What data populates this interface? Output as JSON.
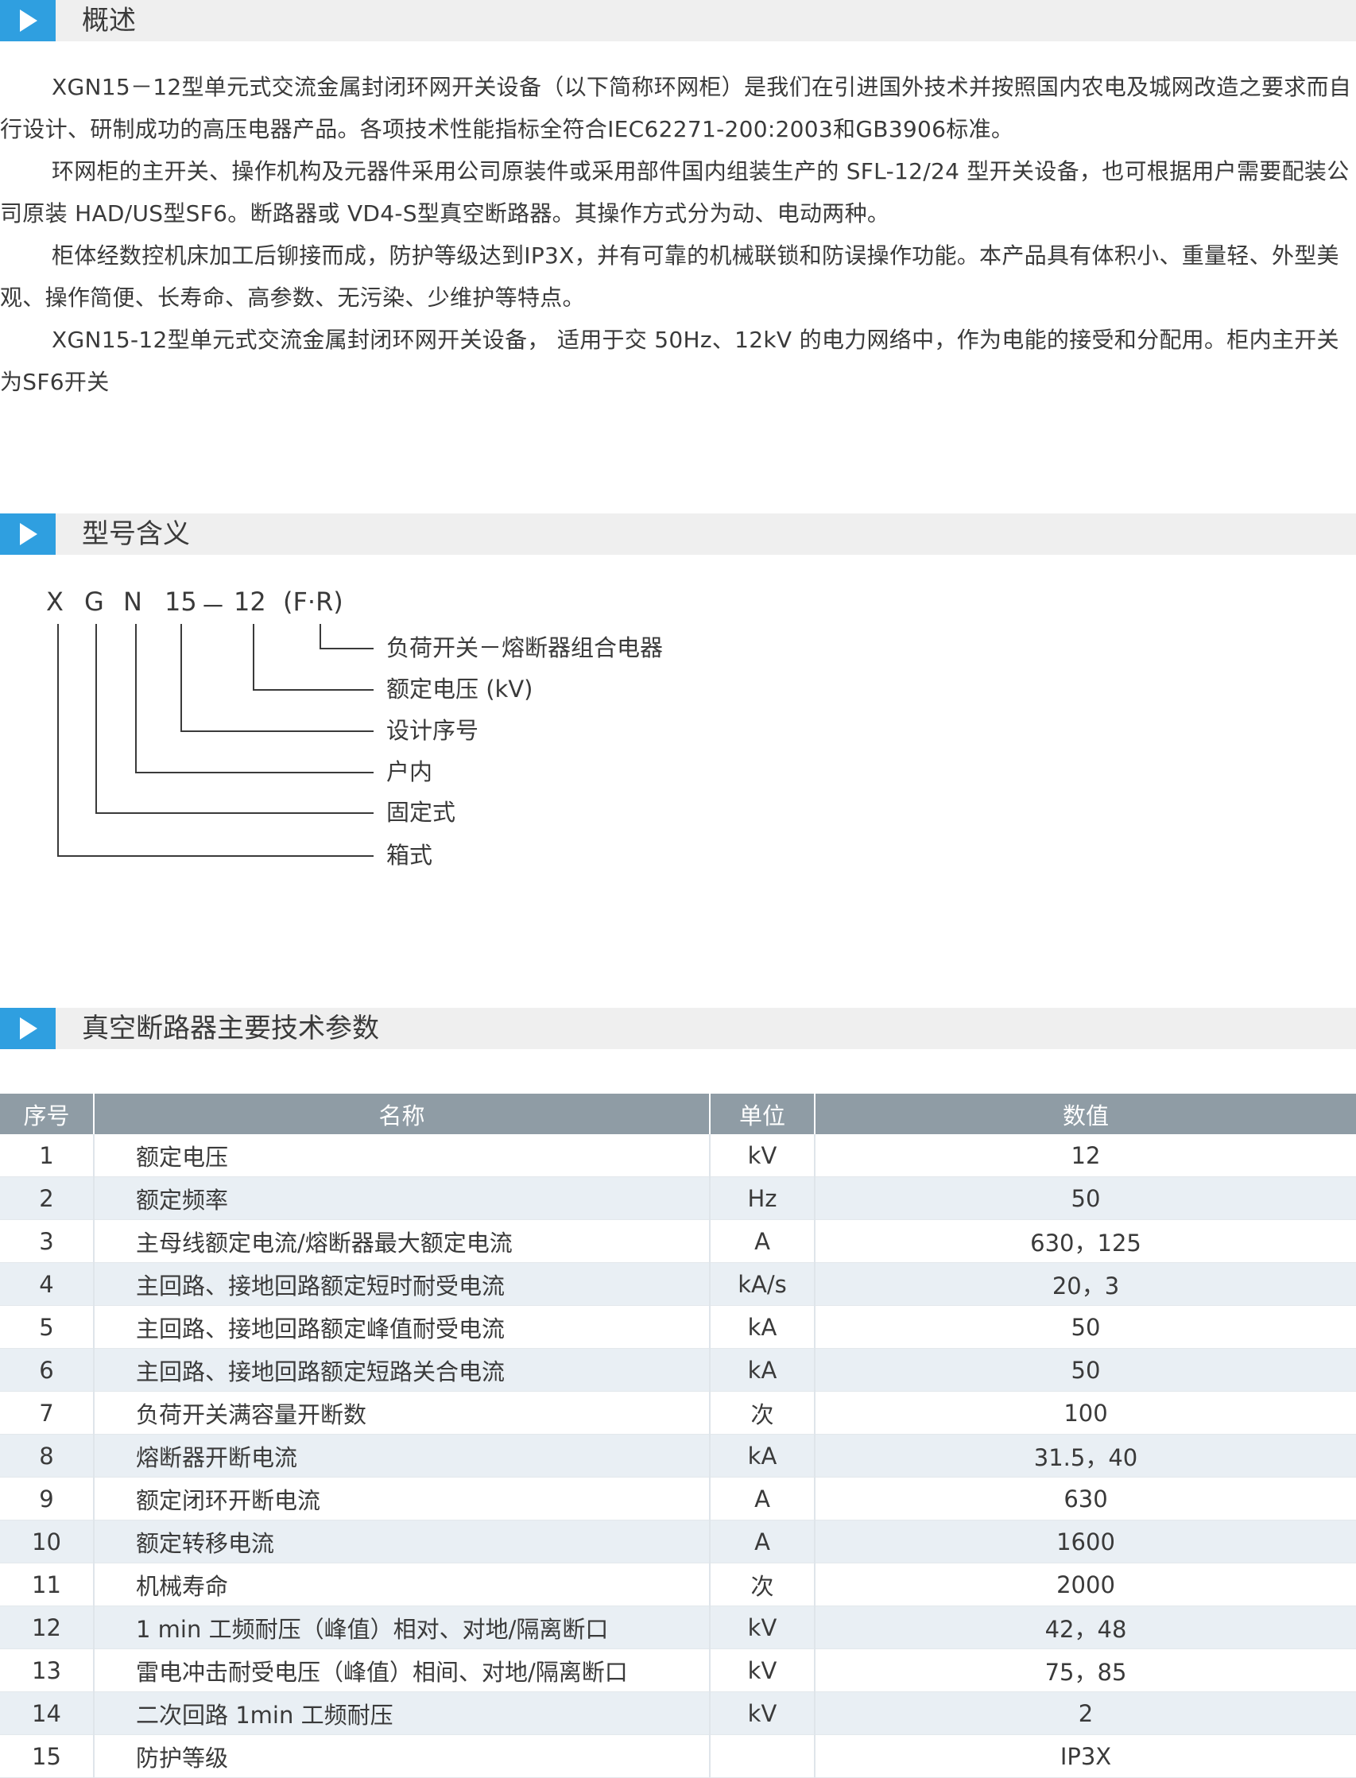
{
  "sections": {
    "overview": {
      "title": "概述"
    },
    "model": {
      "title": "型号含义"
    },
    "params": {
      "title": "真空断路器主要技术参数"
    }
  },
  "overview": {
    "paragraphs": [
      "XGN15－12型单元式交流金属封闭环网开关设备（以下简称环网柜）是我们在引进国外技术并按照国内农电及城网改造之要求而自行设计、研制成功的高压电器产品。各项技术性能指标全符合IEC62271-200:2003和GB3906标准。",
      "环网柜的主开关、操作机构及元器件采用公司原装件或采用部件国内组装生产的 SFL-12/24 型开关设备，也可根据用户需要配装公司原装 HAD/US型SF6。断路器或 VD4-S型真空断路器。其操作方式分为动、电动两种。",
      "柜体经数控机床加工后铆接而成，防护等级达到IP3X，并有可靠的机械联锁和防误操作功能。本产品具有体积小、重量轻、外型美观、操作简便、长寿命、高参数、无污染、少维护等特点。",
      "XGN15-12型单元式交流金属封闭环网开关设备， 适用于交 50Hz、12kV 的电力网络中，作为电能的接受和分配用。柜内主开关为SF6开关"
    ]
  },
  "model": {
    "letters": [
      "X",
      "G",
      "N",
      "15",
      "－",
      "12",
      "(F·R)"
    ],
    "labels": [
      "负荷开关－熔断器组合电器",
      "额定电压 (kV)",
      "设计序号",
      "户内",
      "固定式",
      "箱式"
    ]
  },
  "table": {
    "headers": [
      "序号",
      "名称",
      "单位",
      "数值"
    ],
    "rows": [
      {
        "no": "1",
        "name": "额定电压",
        "unit": "kV",
        "value": "12"
      },
      {
        "no": "2",
        "name": "额定频率",
        "unit": "Hz",
        "value": "50"
      },
      {
        "no": "3",
        "name": "主母线额定电流/熔断器最大额定电流",
        "unit": "A",
        "value": "630，125"
      },
      {
        "no": "4",
        "name": "主回路、接地回路额定短时耐受电流",
        "unit": "kA/s",
        "value": "20，3"
      },
      {
        "no": "5",
        "name": "主回路、接地回路额定峰值耐受电流",
        "unit": "kA",
        "value": "50"
      },
      {
        "no": "6",
        "name": "主回路、接地回路额定短路关合电流",
        "unit": "kA",
        "value": "50"
      },
      {
        "no": "7",
        "name": "负荷开关满容量开断数",
        "unit": "次",
        "value": "100"
      },
      {
        "no": "8",
        "name": "熔断器开断电流",
        "unit": "kA",
        "value": "31.5，40"
      },
      {
        "no": "9",
        "name": "额定闭环开断电流",
        "unit": "A",
        "value": "630"
      },
      {
        "no": "10",
        "name": "额定转移电流",
        "unit": "A",
        "value": "1600"
      },
      {
        "no": "11",
        "name": "机械寿命",
        "unit": "次",
        "value": "2000"
      },
      {
        "no": "12",
        "name": "1 min 工频耐压（峰值）相对、对地/隔离断口",
        "unit": "kV",
        "value": "42，48"
      },
      {
        "no": "13",
        "name": "雷电冲击耐受电压（峰值）相间、对地/隔离断口",
        "unit": "kV",
        "value": "75，85"
      },
      {
        "no": "14",
        "name": "二次回路 1min 工频耐压",
        "unit": "kV",
        "value": "2"
      },
      {
        "no": "15",
        "name": "防护等级",
        "unit": "",
        "value": "IP3X"
      }
    ]
  }
}
